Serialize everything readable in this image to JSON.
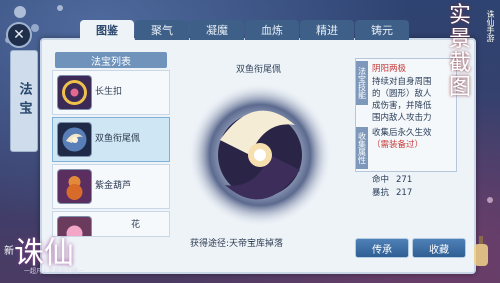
{
  "tabs": [
    {
      "label": "图鉴",
      "active": true
    },
    {
      "label": "聚气",
      "active": false
    },
    {
      "label": "凝魔",
      "active": false
    },
    {
      "label": "血炼",
      "active": false
    },
    {
      "label": "精进",
      "active": false
    },
    {
      "label": "铸元",
      "active": false
    }
  ],
  "side_tab": {
    "label": "法宝"
  },
  "list": {
    "header": "法宝列表",
    "items": [
      {
        "name": "长生扣",
        "selected": false
      },
      {
        "name": "双鱼衔尾佩",
        "selected": true
      },
      {
        "name": "紫金葫芦",
        "selected": false
      },
      {
        "name": "花",
        "selected": false
      }
    ]
  },
  "detail": {
    "title": "双鱼衔尾佩",
    "obtain": "获得途径:天帝宝库掉落",
    "effect_tag": "法宝技能",
    "effect_name": "阴阳两极",
    "effect_lines": [
      "持续对自身周围",
      "的（圆形）敌人",
      "成伤害，并降低",
      "围内敌人攻击力"
    ],
    "collect_tag": "收集属性",
    "collect_lines": [
      "收集后永久生效",
      "（需装备过）"
    ],
    "stats": [
      {
        "label": "命中",
        "value": "271"
      },
      {
        "label": "暴抗",
        "value": "217"
      }
    ]
  },
  "buttons": {
    "inherit": "传承",
    "collect": "收藏"
  },
  "decor": {
    "seal_text": [
      "实",
      "景",
      "截",
      "图"
    ],
    "seal_small": "诛仙手游",
    "logo_main": "诛仙",
    "logo_new": "新",
    "logo_sub": "一超凡入圣再续仙缘一"
  },
  "colors": {
    "accent": "#3d5f88",
    "button": "#2f5e92",
    "highlight": "#c73b3b"
  }
}
